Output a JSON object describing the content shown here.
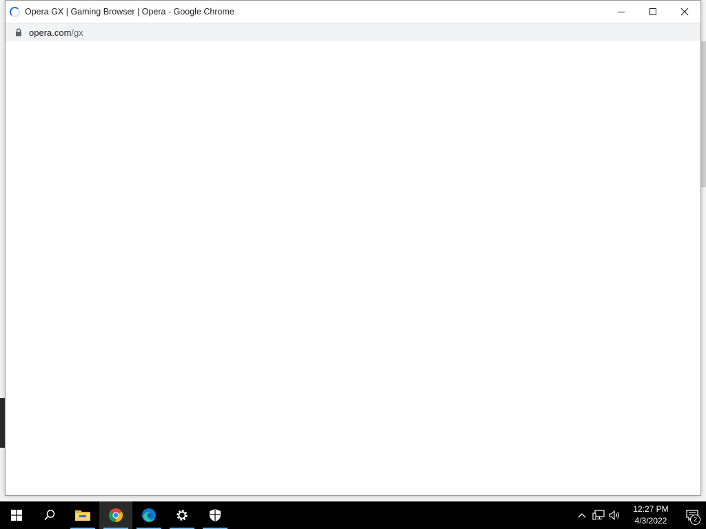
{
  "window": {
    "title": "Opera GX | Gaming Browser | Opera - Google Chrome",
    "url_host": "opera.com",
    "url_path": "/gx",
    "controls": [
      "minimize-icon",
      "maximize-icon",
      "close-icon"
    ]
  },
  "taskbar": {
    "apps": [
      {
        "name": "start",
        "icon": "windows-logo-icon"
      },
      {
        "name": "search",
        "icon": "search-icon"
      },
      {
        "name": "file-explorer",
        "icon": "folder-icon"
      },
      {
        "name": "chrome",
        "icon": "chrome-icon",
        "active": true
      },
      {
        "name": "edge",
        "icon": "edge-icon"
      },
      {
        "name": "settings",
        "icon": "gear-icon"
      },
      {
        "name": "security",
        "icon": "shield-icon"
      }
    ],
    "clock": {
      "time": "12:27 PM",
      "date": "4/3/2022"
    },
    "notifications": {
      "count": "2"
    }
  },
  "colors": {
    "taskbar": "#000000",
    "accent": "#76b9ed",
    "spinner": "#1a73e8",
    "addressbar": "#f1f3f4"
  }
}
